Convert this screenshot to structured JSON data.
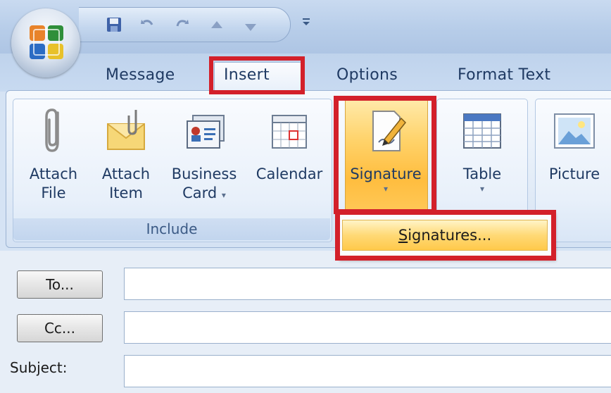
{
  "window": {
    "qat_overflow_icon": "customize-qat-arrow"
  },
  "tabs": [
    {
      "label": "Message"
    },
    {
      "label": "Insert"
    },
    {
      "label": "Options"
    },
    {
      "label": "Format Text"
    }
  ],
  "ribbon": {
    "include_group": {
      "label": "Include",
      "buttons": [
        {
          "line1": "Attach",
          "line2": "File",
          "icon": "paperclip-icon"
        },
        {
          "line1": "Attach",
          "line2": "Item",
          "icon": "envelope-icon"
        },
        {
          "line1": "Business",
          "line2": "Card",
          "icon": "business-card-icon"
        },
        {
          "line1": "Calendar",
          "line2": "",
          "icon": "calendar-icon"
        }
      ]
    },
    "signature": {
      "label": "Signature",
      "icon": "signature-pen-icon"
    },
    "table": {
      "label": "Table",
      "icon": "table-icon"
    },
    "picture": {
      "label": "Picture",
      "icon": "picture-icon"
    }
  },
  "signature_menu": {
    "item_prefix_underlined": "S",
    "item_rest": "ignatures..."
  },
  "form": {
    "to_button": "To...",
    "cc_button": "Cc...",
    "subject_label": "Subject:",
    "to_value": "",
    "cc_value": "",
    "subject_value": ""
  },
  "colors": {
    "highlight_red": "#d3202a",
    "signature_hover": "#ffd36b"
  }
}
